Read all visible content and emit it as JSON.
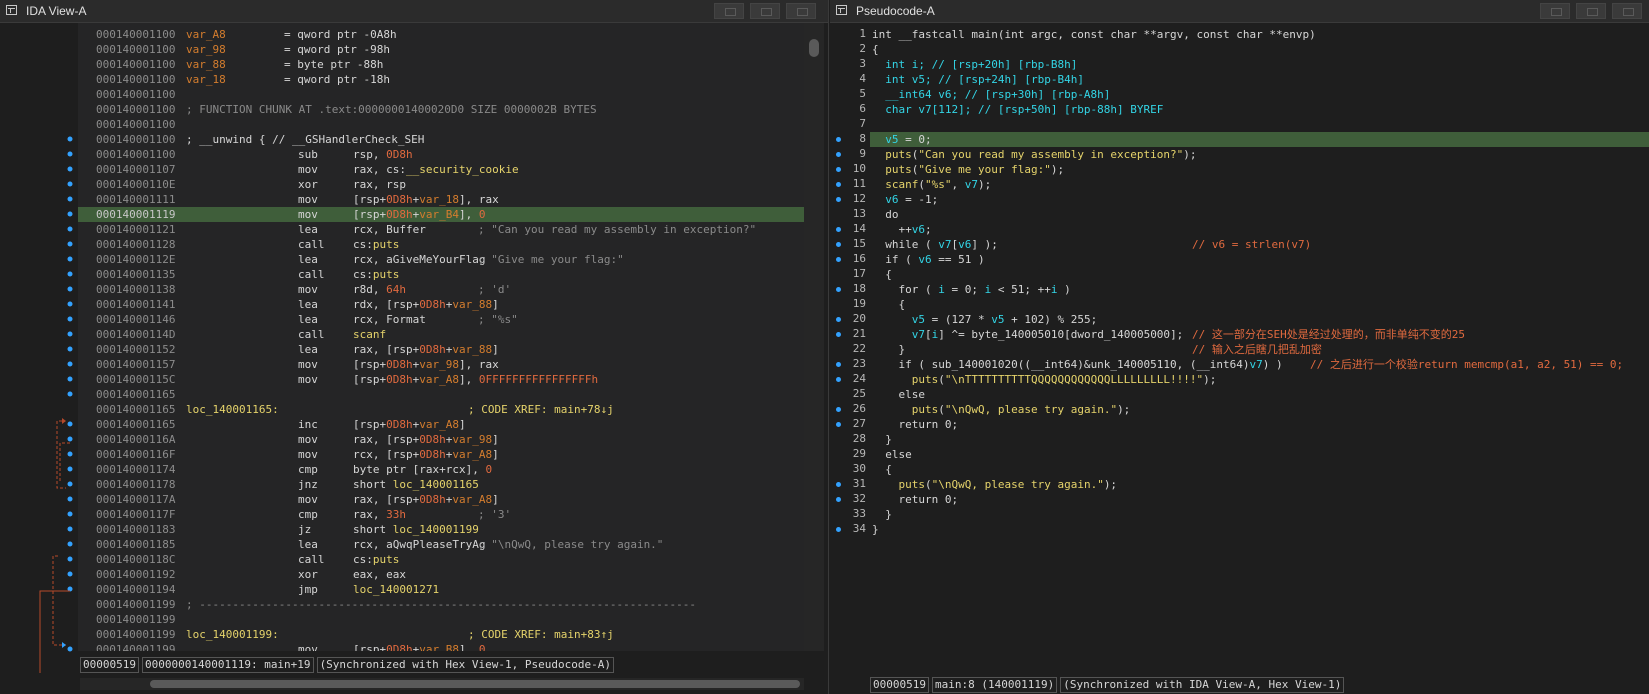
{
  "ida": {
    "title": "IDA View-A",
    "lines": [
      {
        "addr": "000140001100",
        "label": "var_A8",
        "mn": "= qword ptr -0A8h",
        "op": "",
        "comment": ""
      },
      {
        "addr": "000140001100",
        "label": "var_98",
        "mn": "= qword ptr -98h",
        "op": "",
        "comment": ""
      },
      {
        "addr": "000140001100",
        "label": "var_88",
        "mn": "= byte ptr -88h",
        "op": "",
        "comment": ""
      },
      {
        "addr": "000140001100",
        "label": "var_18",
        "mn": "= qword ptr -18h",
        "op": "",
        "comment": ""
      },
      {
        "addr": "000140001100",
        "label": "",
        "mn": "",
        "op": "",
        "comment": ""
      },
      {
        "addr": "000140001100",
        "label": "; FUNCTION CHUNK AT .text:00000001400020D0 SIZE 0000002B BYTES",
        "mn": "",
        "op": "",
        "comment": ""
      },
      {
        "addr": "000140001100",
        "label": "",
        "mn": "",
        "op": "",
        "comment": ""
      },
      {
        "addr": "000140001100",
        "label": "; __unwind { // __GSHandlerCheck_SEH",
        "mn": "",
        "op": "",
        "comment": ""
      },
      {
        "addr": "000140001100",
        "label": "",
        "mn": "sub",
        "op": "rsp, 0D8h",
        "comment": ""
      },
      {
        "addr": "000140001107",
        "label": "",
        "mn": "mov",
        "op": "rax, cs:__security_cookie",
        "comment": ""
      },
      {
        "addr": "00014000110E",
        "label": "",
        "mn": "xor",
        "op": "rax, rsp",
        "comment": ""
      },
      {
        "addr": "000140001111",
        "label": "",
        "mn": "mov",
        "op": "[rsp+0D8h+var_18], rax",
        "comment": ""
      },
      {
        "addr": "000140001119",
        "label": "",
        "mn": "mov",
        "op": "[rsp+0D8h+var_B4], 0",
        "comment": ""
      },
      {
        "addr": "000140001121",
        "label": "",
        "mn": "lea",
        "op": "rcx, Buffer",
        "comment": "; \"Can you read my assembly in exception?\""
      },
      {
        "addr": "000140001128",
        "label": "",
        "mn": "call",
        "op": "cs:puts",
        "comment": ""
      },
      {
        "addr": "00014000112E",
        "label": "",
        "mn": "lea",
        "op": "rcx, aGiveMeYourFlag",
        "comment": "; \"Give me your flag:\""
      },
      {
        "addr": "000140001135",
        "label": "",
        "mn": "call",
        "op": "cs:puts",
        "comment": ""
      },
      {
        "addr": "000140001138",
        "label": "",
        "mn": "mov",
        "op": "r8d, 64h",
        "comment": "; 'd'"
      },
      {
        "addr": "000140001141",
        "label": "",
        "mn": "lea",
        "op": "rdx, [rsp+0D8h+var_88]",
        "comment": ""
      },
      {
        "addr": "000140001146",
        "label": "",
        "mn": "lea",
        "op": "rcx, Format",
        "comment": "; \"%s\""
      },
      {
        "addr": "00014000114D",
        "label": "",
        "mn": "call",
        "op": "scanf",
        "comment": ""
      },
      {
        "addr": "000140001152",
        "label": "",
        "mn": "lea",
        "op": "rax, [rsp+0D8h+var_88]",
        "comment": ""
      },
      {
        "addr": "000140001157",
        "label": "",
        "mn": "mov",
        "op": "[rsp+0D8h+var_98], rax",
        "comment": ""
      },
      {
        "addr": "00014000115C",
        "label": "",
        "mn": "mov",
        "op": "[rsp+0D8h+var_A8], 0FFFFFFFFFFFFFFFFh",
        "comment": ""
      },
      {
        "addr": "000140001165",
        "label": "",
        "mn": "",
        "op": "",
        "comment": ""
      },
      {
        "addr": "000140001165",
        "label": "loc_140001165:",
        "mn": "",
        "op": "",
        "comment": "; CODE XREF: main+78↓j"
      },
      {
        "addr": "000140001165",
        "label": "",
        "mn": "inc",
        "op": "[rsp+0D8h+var_A8]",
        "comment": ""
      },
      {
        "addr": "00014000116A",
        "label": "",
        "mn": "mov",
        "op": "rax, [rsp+0D8h+var_98]",
        "comment": ""
      },
      {
        "addr": "00014000116F",
        "label": "",
        "mn": "mov",
        "op": "rcx, [rsp+0D8h+var_A8]",
        "comment": ""
      },
      {
        "addr": "000140001174",
        "label": "",
        "mn": "cmp",
        "op": "byte ptr [rax+rcx], 0",
        "comment": ""
      },
      {
        "addr": "000140001178",
        "label": "",
        "mn": "jnz",
        "op": "short loc_140001165",
        "comment": ""
      },
      {
        "addr": "00014000117A",
        "label": "",
        "mn": "mov",
        "op": "rax, [rsp+0D8h+var_A8]",
        "comment": ""
      },
      {
        "addr": "00014000117F",
        "label": "",
        "mn": "cmp",
        "op": "rax, 33h",
        "comment": "; '3'"
      },
      {
        "addr": "000140001183",
        "label": "",
        "mn": "jz",
        "op": "short loc_140001199",
        "comment": ""
      },
      {
        "addr": "000140001185",
        "label": "",
        "mn": "lea",
        "op": "rcx, aQwqPleaseTryAg",
        "comment": "; \"\\nQwQ, please try again.\""
      },
      {
        "addr": "00014000118C",
        "label": "",
        "mn": "call",
        "op": "cs:puts",
        "comment": ""
      },
      {
        "addr": "000140001192",
        "label": "",
        "mn": "xor",
        "op": "eax, eax",
        "comment": ""
      },
      {
        "addr": "000140001194",
        "label": "",
        "mn": "jmp",
        "op": "loc_140001271",
        "comment": ""
      },
      {
        "addr": "000140001199",
        "label": "; ---------------------------------------------------------------------------",
        "mn": "",
        "op": "",
        "comment": ""
      },
      {
        "addr": "000140001199",
        "label": "",
        "mn": "",
        "op": "",
        "comment": ""
      },
      {
        "addr": "000140001199",
        "label": "loc_140001199:",
        "mn": "",
        "op": "",
        "comment": "; CODE XREF: main+83↑j"
      },
      {
        "addr": "000140001199",
        "label": "",
        "mn": "mov",
        "op": "[rsp+0D8h+var_B8], 0",
        "comment": ""
      }
    ],
    "status": {
      "offset": "00000519",
      "location": "0000000140001119: main+19",
      "sync": "(Synchronized with Hex View-1, Pseudocode-A)"
    }
  },
  "pseudo": {
    "title": "Pseudocode-A",
    "lines": [
      {
        "n": "1",
        "text": "int __fastcall main(int argc, const char **argv, const char **envp)"
      },
      {
        "n": "2",
        "text": "{"
      },
      {
        "n": "3",
        "text": "  int i; // [rsp+20h] [rbp-B8h]"
      },
      {
        "n": "4",
        "text": "  int v5; // [rsp+24h] [rbp-B4h]"
      },
      {
        "n": "5",
        "text": "  __int64 v6; // [rsp+30h] [rbp-A8h]"
      },
      {
        "n": "6",
        "text": "  char v7[112]; // [rsp+50h] [rbp-88h] BYREF"
      },
      {
        "n": "7",
        "text": ""
      },
      {
        "n": "8",
        "text": "  v5 = 0;"
      },
      {
        "n": "9",
        "text": "  puts(\"Can you read my assembly in exception?\");"
      },
      {
        "n": "10",
        "text": "  puts(\"Give me your flag:\");"
      },
      {
        "n": "11",
        "text": "  scanf(\"%s\", v7);"
      },
      {
        "n": "12",
        "text": "  v6 = -1;"
      },
      {
        "n": "13",
        "text": "  do"
      },
      {
        "n": "14",
        "text": "    ++v6;"
      },
      {
        "n": "15",
        "text": "  while ( v7[v6] );"
      },
      {
        "n": "16",
        "text": "  if ( v6 == 51 )"
      },
      {
        "n": "17",
        "text": "  {"
      },
      {
        "n": "18",
        "text": "    for ( i = 0; i < 51; ++i )"
      },
      {
        "n": "19",
        "text": "    {"
      },
      {
        "n": "20",
        "text": "      v5 = (127 * v5 + 102) % 255;"
      },
      {
        "n": "21",
        "text": "      v7[i] ^= byte_140005010[dword_140005000];"
      },
      {
        "n": "22",
        "text": "    }"
      },
      {
        "n": "23",
        "text": "    if ( sub_140001020((__int64)&unk_140005110, (__int64)v7) )"
      },
      {
        "n": "24",
        "text": "      puts(\"\\nTTTTTTTTTTQQQQQQQQQQQQLLLLLLLLL!!!!\");"
      },
      {
        "n": "25",
        "text": "    else"
      },
      {
        "n": "26",
        "text": "      puts(\"\\nQwQ, please try again.\");"
      },
      {
        "n": "27",
        "text": "    return 0;"
      },
      {
        "n": "28",
        "text": "  }"
      },
      {
        "n": "29",
        "text": "  else"
      },
      {
        "n": "30",
        "text": "  {"
      },
      {
        "n": "31",
        "text": "    puts(\"\\nQwQ, please try again.\");"
      },
      {
        "n": "32",
        "text": "    return 0;"
      },
      {
        "n": "33",
        "text": "  }"
      },
      {
        "n": "34",
        "text": "}"
      }
    ],
    "comments": {
      "line15": "// v6 = strlen(v7)",
      "line21": "// 这一部分在SEH处是经过处理的，而非单纯不变的25",
      "line22": "// 输入之后瞎几把乱加密",
      "line23": "// 之后进行一个校验return memcmp(a1, a2, 51) == 0;"
    },
    "status": {
      "offset": "00000519",
      "location": "main:8 (140001119)",
      "sync": "(Synchronized with IDA View-A, Hex View-1)"
    }
  }
}
